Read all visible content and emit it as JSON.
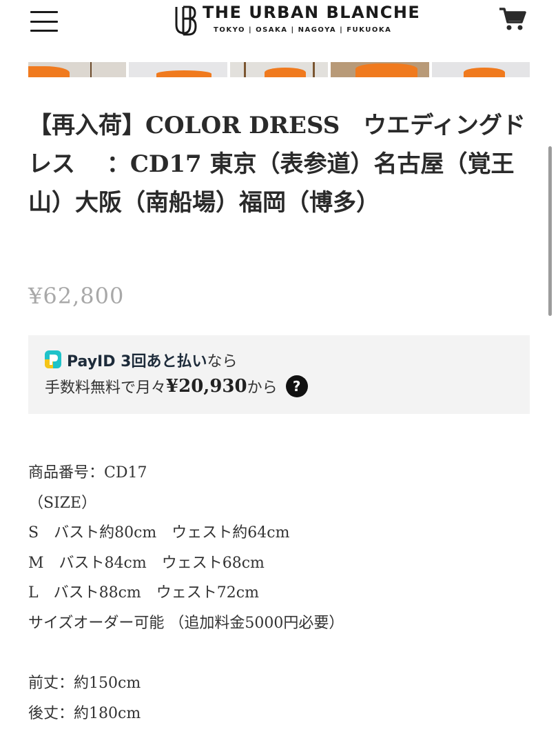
{
  "header": {
    "brand_title": "THE URBAN BLANCHE",
    "brand_subtitle": "TOKYO | OSAKA | NAGOYA | FUKUOKA",
    "menu_icon": "hamburger-menu-icon",
    "cart_icon": "shopping-cart-icon"
  },
  "gallery": {
    "thumbnail_count": 5,
    "accent_color": "#f07a1e"
  },
  "product": {
    "title": "【再入荷】COLOR DRESS　ウエディングドレス　 ：CD17 東京（表参道）名古屋（覚王山）大阪（南船場）福岡（博多）",
    "price": "¥62,800"
  },
  "payid": {
    "brand": "PayID 3回あと払い",
    "suffix": "なら",
    "line2_prefix": "手数料無料で月々",
    "amount": "¥20,930",
    "line2_suffix": "から",
    "help_label": "?"
  },
  "description": {
    "lines": [
      "商品番号：CD17",
      "（SIZE）",
      "S　バスト約80cm　ウェスト約64cm",
      "M　バスト84cm　ウェスト68cm",
      "L　バスト88cm　ウェスト72cm",
      "サイズオーダー可能 （追加料金5000円必要）"
    ],
    "length_lines": [
      "前丈：約150cm",
      "後丈：約180cm"
    ]
  }
}
